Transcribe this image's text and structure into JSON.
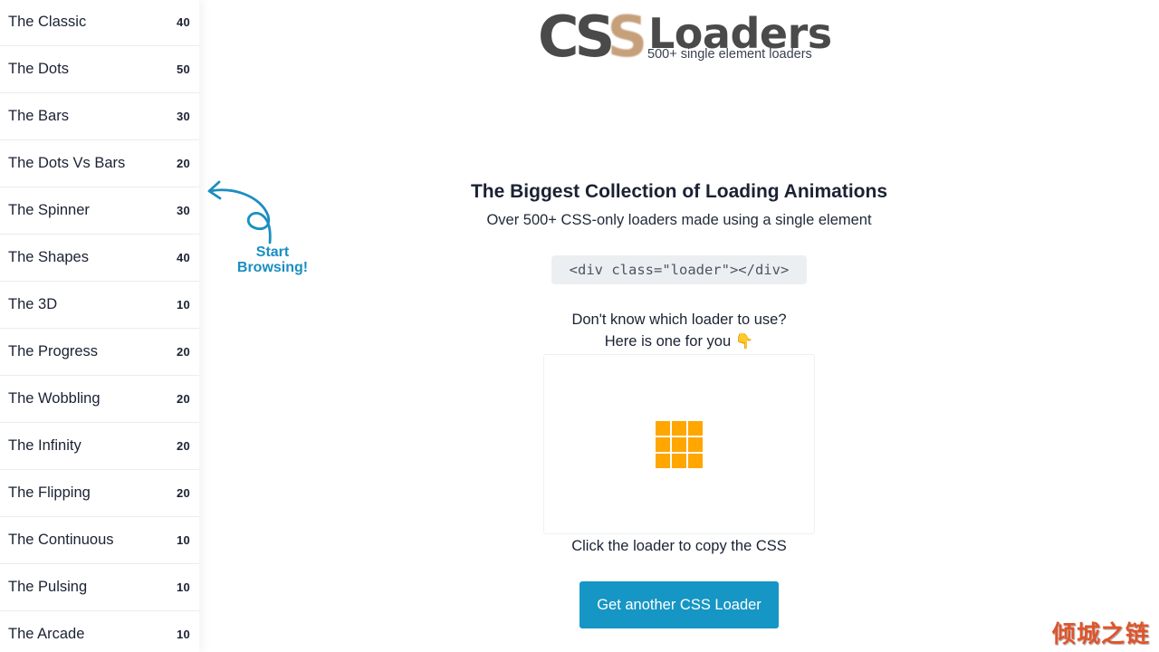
{
  "logo": {
    "css_c": "C",
    "css_s1": "S",
    "css_s2": "S",
    "title": "Loaders",
    "tagline": "500+ single element loaders"
  },
  "sidebar": {
    "items": [
      {
        "label": "The Classic",
        "count": "40"
      },
      {
        "label": "The Dots",
        "count": "50"
      },
      {
        "label": "The Bars",
        "count": "30"
      },
      {
        "label": "The Dots Vs Bars",
        "count": "20"
      },
      {
        "label": "The Spinner",
        "count": "30"
      },
      {
        "label": "The Shapes",
        "count": "40"
      },
      {
        "label": "The 3D",
        "count": "10"
      },
      {
        "label": "The Progress",
        "count": "20"
      },
      {
        "label": "The Wobbling",
        "count": "20"
      },
      {
        "label": "The Infinity",
        "count": "20"
      },
      {
        "label": "The Flipping",
        "count": "20"
      },
      {
        "label": "The Continuous",
        "count": "10"
      },
      {
        "label": "The Pulsing",
        "count": "10"
      },
      {
        "label": "The Arcade",
        "count": "10"
      }
    ]
  },
  "callout": {
    "line1": "Start",
    "line2": "Browsing!",
    "icon": "curly-arrow-left-icon"
  },
  "main": {
    "headline": "The Biggest Collection of Loading Animations",
    "subheadline": "Over 500+ CSS-only loaders made using a single element",
    "code_snippet": "<div class=\"loader\"></div>",
    "prompt_line1": "Don't know which loader to use?",
    "prompt_line2": "Here is one for you",
    "prompt_emoji": "👇",
    "loader": {
      "type": "3x3 square grid",
      "cells": 9
    },
    "copy_hint": "Click the loader to copy the CSS",
    "cta_label": "Get another CSS Loader"
  },
  "watermark": "倾城之链",
  "colors": {
    "accent": "#1696c4",
    "callout": "#1b8ec1",
    "loader": "#ffa600",
    "logo_dark": "#4a4a4a",
    "logo_s": "#c6a07a",
    "watermark": "#e0542a"
  }
}
